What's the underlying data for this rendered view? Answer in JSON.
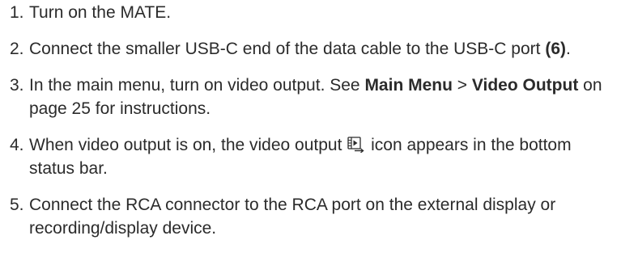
{
  "steps": [
    {
      "number": "1.",
      "text": "Turn on the MATE."
    },
    {
      "number": "2.",
      "text_a": "Connect the smaller USB-C end of the data cable to the USB-C port ",
      "text_bold": "(6)",
      "text_b": "."
    },
    {
      "number": "3.",
      "text_a": "In the main menu, turn on video output. See ",
      "bold_1": "Main Menu",
      "sep": " > ",
      "bold_2": "Video Output",
      "text_b": " on page 25 for instructions."
    },
    {
      "number": "4.",
      "text_a": "When video output is on, the video output ",
      "icon": "video-output-icon",
      "text_b": " icon appears in the bottom status bar."
    },
    {
      "number": "5.",
      "text": "Connect the RCA connector to the RCA port on the external display or recording/display device."
    }
  ]
}
